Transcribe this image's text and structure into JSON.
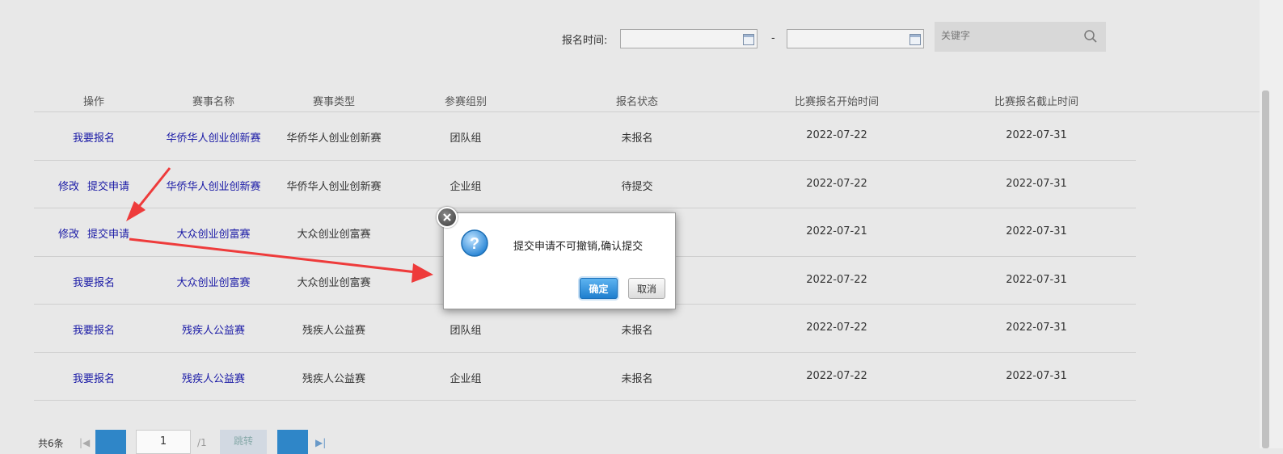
{
  "filter": {
    "time_label": "报名时间:",
    "start_date_value": "",
    "end_date_value": "",
    "dash": "-",
    "search_placeholder": "关键字"
  },
  "table": {
    "headers": [
      "操作",
      "赛事名称",
      "赛事类型",
      "参赛组别",
      "报名状态",
      "比赛报名开始时间",
      "比赛报名截止时间"
    ],
    "rows": [
      {
        "actions": [
          "我要报名"
        ],
        "name": "华侨华人创业创新赛",
        "type": "华侨华人创业创新赛",
        "group": "团队组",
        "status": "未报名",
        "start": "2022-07-22",
        "end": "2022-07-31"
      },
      {
        "actions": [
          "修改",
          "提交申请"
        ],
        "name": "华侨华人创业创新赛",
        "type": "华侨华人创业创新赛",
        "group": "企业组",
        "status": "待提交",
        "start": "2022-07-22",
        "end": "2022-07-31"
      },
      {
        "actions": [
          "修改",
          "提交申请"
        ],
        "name": "大众创业创富赛",
        "type": "大众创业创富赛",
        "group": "",
        "status": "",
        "start": "2022-07-21",
        "end": "2022-07-31"
      },
      {
        "actions": [
          "我要报名"
        ],
        "name": "大众创业创富赛",
        "type": "大众创业创富赛",
        "group": "",
        "status": "",
        "start": "2022-07-22",
        "end": "2022-07-31"
      },
      {
        "actions": [
          "我要报名"
        ],
        "name": "残疾人公益赛",
        "type": "残疾人公益赛",
        "group": "团队组",
        "status": "未报名",
        "start": "2022-07-22",
        "end": "2022-07-31"
      },
      {
        "actions": [
          "我要报名"
        ],
        "name": "残疾人公益赛",
        "type": "残疾人公益赛",
        "group": "企业组",
        "status": "未报名",
        "start": "2022-07-22",
        "end": "2022-07-31"
      }
    ]
  },
  "dialog": {
    "message": "提交申请不可撤销,确认提交",
    "ok_label": "确定",
    "cancel_label": "取消"
  },
  "pager": {
    "total": "共6条",
    "current_page": "1",
    "of_text": "/1",
    "jump_label": "跳转"
  },
  "colors": {
    "link": "#1a1aa6",
    "annotation_arrow": "#ee3b3b",
    "primary_button": "#1f7fcf"
  }
}
